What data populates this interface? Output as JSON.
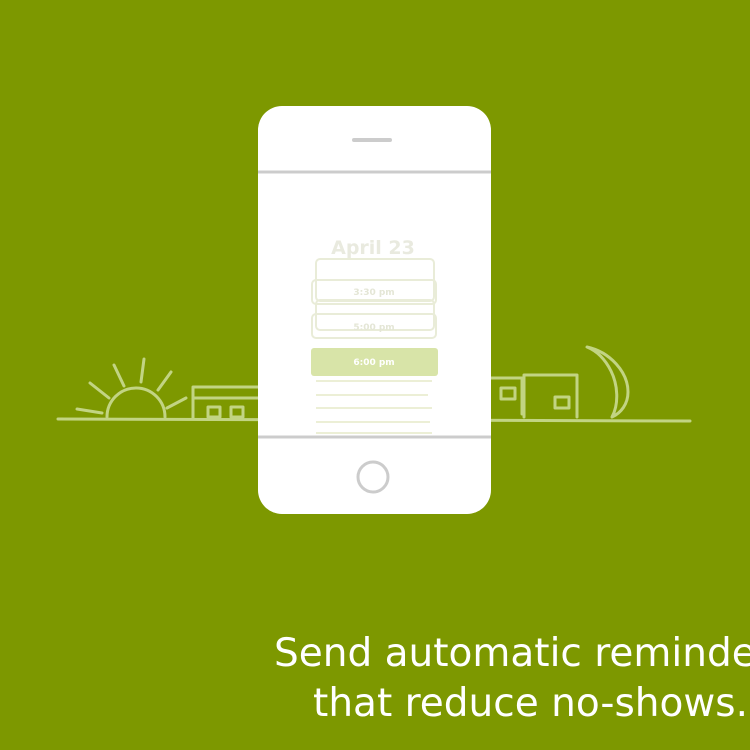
{
  "colors": {
    "background": "#7d9800",
    "phone": "#ffffff",
    "line_art": "#c2d483",
    "screen_line": "#ecefd6",
    "selected_row": "#d8e4a8"
  },
  "calendar": {
    "date": "April 23",
    "times": [
      {
        "label": "3:30 pm",
        "selected": false
      },
      {
        "label": "5:00 pm",
        "selected": false
      },
      {
        "label": "6:00 pm",
        "selected": true
      }
    ]
  },
  "caption": {
    "line1": "Send automatic reminders",
    "line2": "that reduce no-shows."
  },
  "icons": [
    "sun-icon",
    "moon-icon",
    "house-icon",
    "home-button-icon"
  ]
}
